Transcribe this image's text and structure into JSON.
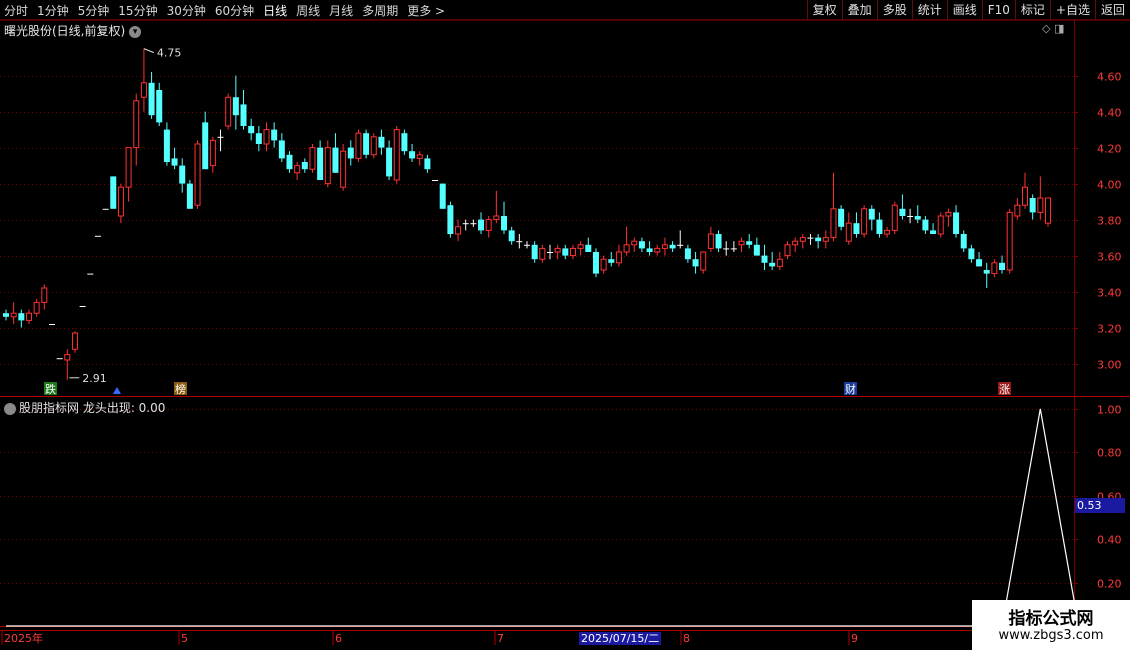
{
  "toolbar": {
    "periods": [
      "分时",
      "1分钟",
      "5分钟",
      "15分钟",
      "30分钟",
      "60分钟",
      "日线",
      "周线",
      "月线",
      "多周期",
      "更多 >"
    ],
    "active_period": "日线",
    "actions": [
      "复权",
      "叠加",
      "多股",
      "统计",
      "画线",
      "F10",
      "标记",
      "+自选",
      "返回"
    ]
  },
  "chart_header": {
    "title": "曙光股份(日线,前复权)",
    "menu_icon": "chevron-down-icon"
  },
  "indicator": {
    "title": "股朋指标网 龙头出现: 0.00",
    "current_value": "0.53"
  },
  "annotations": {
    "high": "4.75",
    "low": "2.91",
    "badges": [
      "跌",
      "榜",
      "财",
      "涨"
    ]
  },
  "watermark": {
    "title": "指标公式网",
    "url": "www.zbgs3.com"
  },
  "time_axis": {
    "labels": [
      "2025年",
      "5",
      "6",
      "7",
      "2025/07/15/二",
      "8",
      "9"
    ],
    "cursor_date": "2025/07/15/二"
  },
  "colors": {
    "up": "#ff3232",
    "down": "#54ffff",
    "grid": "#7a0000",
    "axis_text": "#ff3a3a",
    "flat": "#ffffff"
  },
  "chart_data": [
    {
      "type": "candlestick",
      "title": "曙光股份(日线,前复权)",
      "y_ticks": [
        "4.60",
        "4.40",
        "4.20",
        "4.00",
        "3.80",
        "3.60",
        "3.40",
        "3.20",
        "3.00"
      ],
      "ylim": [
        2.82,
        4.82
      ],
      "x_labels": [
        "2025年",
        "5",
        "6",
        "7",
        "8",
        "9"
      ],
      "ohlc": [
        [
          3.28,
          3.3,
          3.24,
          3.26
        ],
        [
          3.26,
          3.34,
          3.22,
          3.28
        ],
        [
          3.28,
          3.3,
          3.2,
          3.24
        ],
        [
          3.24,
          3.3,
          3.22,
          3.28
        ],
        [
          3.28,
          3.36,
          3.26,
          3.34
        ],
        [
          3.34,
          3.44,
          3.3,
          3.42
        ],
        [
          3.22,
          3.22,
          3.22,
          3.22
        ],
        [
          3.03,
          3.03,
          3.03,
          3.03
        ],
        [
          3.02,
          3.08,
          2.91,
          3.05
        ],
        [
          3.08,
          3.18,
          3.06,
          3.17
        ],
        [
          3.32,
          3.32,
          3.32,
          3.32
        ],
        [
          3.5,
          3.5,
          3.5,
          3.5
        ],
        [
          3.71,
          3.71,
          3.71,
          3.71
        ],
        [
          3.86,
          3.86,
          3.86,
          3.86
        ],
        [
          4.04,
          4.04,
          3.86,
          3.86
        ],
        [
          3.82,
          4.0,
          3.78,
          3.98
        ],
        [
          3.98,
          4.2,
          3.9,
          4.2
        ],
        [
          4.2,
          4.5,
          4.1,
          4.46
        ],
        [
          4.48,
          4.75,
          4.4,
          4.56
        ],
        [
          4.56,
          4.62,
          4.36,
          4.38
        ],
        [
          4.52,
          4.56,
          4.32,
          4.34
        ],
        [
          4.3,
          4.34,
          4.1,
          4.12
        ],
        [
          4.14,
          4.2,
          4.08,
          4.1
        ],
        [
          4.1,
          4.14,
          3.95,
          4.0
        ],
        [
          4.0,
          4.02,
          3.86,
          3.86
        ],
        [
          3.88,
          4.24,
          3.86,
          4.22
        ],
        [
          4.34,
          4.4,
          4.08,
          4.08
        ],
        [
          4.1,
          4.26,
          4.06,
          4.24
        ],
        [
          4.26,
          4.3,
          4.18,
          4.26
        ],
        [
          4.32,
          4.5,
          4.3,
          4.48
        ],
        [
          4.48,
          4.6,
          4.3,
          4.38
        ],
        [
          4.44,
          4.52,
          4.3,
          4.32
        ],
        [
          4.32,
          4.36,
          4.24,
          4.28
        ],
        [
          4.28,
          4.32,
          4.18,
          4.22
        ],
        [
          4.22,
          4.34,
          4.18,
          4.3
        ],
        [
          4.3,
          4.34,
          4.2,
          4.24
        ],
        [
          4.24,
          4.28,
          4.12,
          4.14
        ],
        [
          4.16,
          4.18,
          4.06,
          4.08
        ],
        [
          4.06,
          4.12,
          4.02,
          4.1
        ],
        [
          4.12,
          4.14,
          4.06,
          4.08
        ],
        [
          4.08,
          4.22,
          4.06,
          4.2
        ],
        [
          4.2,
          4.24,
          4.02,
          4.02
        ],
        [
          4.0,
          4.24,
          3.98,
          4.2
        ],
        [
          4.2,
          4.28,
          4.06,
          4.06
        ],
        [
          3.98,
          4.22,
          3.96,
          4.18
        ],
        [
          4.2,
          4.24,
          4.1,
          4.14
        ],
        [
          4.14,
          4.3,
          4.12,
          4.28
        ],
        [
          4.28,
          4.3,
          4.14,
          4.16
        ],
        [
          4.16,
          4.28,
          4.14,
          4.26
        ],
        [
          4.26,
          4.3,
          4.16,
          4.2
        ],
        [
          4.2,
          4.24,
          4.02,
          4.04
        ],
        [
          4.02,
          4.32,
          4.0,
          4.3
        ],
        [
          4.28,
          4.3,
          4.16,
          4.18
        ],
        [
          4.18,
          4.22,
          4.12,
          4.14
        ],
        [
          4.14,
          4.18,
          4.1,
          4.16
        ],
        [
          4.14,
          4.16,
          4.06,
          4.08
        ],
        [
          4.02,
          4.02,
          4.02,
          4.02
        ],
        [
          4.0,
          4.0,
          3.86,
          3.86
        ],
        [
          3.88,
          3.9,
          3.7,
          3.72
        ],
        [
          3.72,
          3.8,
          3.68,
          3.76
        ],
        [
          3.78,
          3.8,
          3.74,
          3.78
        ],
        [
          3.78,
          3.8,
          3.76,
          3.78
        ],
        [
          3.8,
          3.84,
          3.72,
          3.74
        ],
        [
          3.74,
          3.82,
          3.7,
          3.8
        ],
        [
          3.8,
          3.96,
          3.78,
          3.82
        ],
        [
          3.82,
          3.9,
          3.72,
          3.74
        ],
        [
          3.74,
          3.76,
          3.66,
          3.68
        ],
        [
          3.68,
          3.72,
          3.64,
          3.68
        ],
        [
          3.66,
          3.68,
          3.64,
          3.66
        ],
        [
          3.66,
          3.68,
          3.56,
          3.58
        ],
        [
          3.58,
          3.66,
          3.56,
          3.64
        ],
        [
          3.62,
          3.66,
          3.58,
          3.62
        ],
        [
          3.62,
          3.66,
          3.58,
          3.64
        ],
        [
          3.64,
          3.66,
          3.58,
          3.6
        ],
        [
          3.6,
          3.66,
          3.58,
          3.64
        ],
        [
          3.64,
          3.68,
          3.6,
          3.66
        ],
        [
          3.66,
          3.7,
          3.62,
          3.62
        ],
        [
          3.62,
          3.64,
          3.48,
          3.5
        ],
        [
          3.52,
          3.6,
          3.5,
          3.58
        ],
        [
          3.58,
          3.62,
          3.54,
          3.56
        ],
        [
          3.56,
          3.66,
          3.54,
          3.62
        ],
        [
          3.62,
          3.76,
          3.6,
          3.66
        ],
        [
          3.66,
          3.7,
          3.62,
          3.68
        ],
        [
          3.68,
          3.7,
          3.62,
          3.64
        ],
        [
          3.64,
          3.68,
          3.6,
          3.62
        ],
        [
          3.62,
          3.66,
          3.6,
          3.64
        ],
        [
          3.64,
          3.7,
          3.6,
          3.66
        ],
        [
          3.66,
          3.68,
          3.62,
          3.64
        ],
        [
          3.66,
          3.74,
          3.64,
          3.66
        ],
        [
          3.64,
          3.66,
          3.56,
          3.58
        ],
        [
          3.58,
          3.62,
          3.5,
          3.54
        ],
        [
          3.52,
          3.62,
          3.5,
          3.62
        ],
        [
          3.64,
          3.76,
          3.62,
          3.72
        ],
        [
          3.72,
          3.74,
          3.62,
          3.64
        ],
        [
          3.64,
          3.68,
          3.6,
          3.64
        ],
        [
          3.64,
          3.68,
          3.62,
          3.64
        ],
        [
          3.66,
          3.7,
          3.62,
          3.68
        ],
        [
          3.68,
          3.72,
          3.64,
          3.66
        ],
        [
          3.66,
          3.7,
          3.6,
          3.6
        ],
        [
          3.6,
          3.66,
          3.52,
          3.56
        ],
        [
          3.56,
          3.62,
          3.52,
          3.54
        ],
        [
          3.54,
          3.62,
          3.52,
          3.58
        ],
        [
          3.6,
          3.68,
          3.58,
          3.66
        ],
        [
          3.66,
          3.7,
          3.62,
          3.68
        ],
        [
          3.68,
          3.72,
          3.64,
          3.7
        ],
        [
          3.7,
          3.72,
          3.66,
          3.7
        ],
        [
          3.7,
          3.72,
          3.64,
          3.68
        ],
        [
          3.68,
          3.74,
          3.64,
          3.7
        ],
        [
          3.7,
          4.06,
          3.68,
          3.86
        ],
        [
          3.86,
          3.88,
          3.74,
          3.76
        ],
        [
          3.68,
          3.84,
          3.66,
          3.78
        ],
        [
          3.78,
          3.84,
          3.7,
          3.72
        ],
        [
          3.72,
          3.88,
          3.7,
          3.86
        ],
        [
          3.86,
          3.88,
          3.74,
          3.8
        ],
        [
          3.8,
          3.84,
          3.7,
          3.72
        ],
        [
          3.72,
          3.76,
          3.7,
          3.74
        ],
        [
          3.74,
          3.9,
          3.72,
          3.88
        ],
        [
          3.86,
          3.94,
          3.8,
          3.82
        ],
        [
          3.82,
          3.86,
          3.78,
          3.82
        ],
        [
          3.82,
          3.88,
          3.78,
          3.8
        ],
        [
          3.8,
          3.82,
          3.72,
          3.74
        ],
        [
          3.74,
          3.78,
          3.72,
          3.72
        ],
        [
          3.72,
          3.84,
          3.7,
          3.82
        ],
        [
          3.82,
          3.86,
          3.76,
          3.84
        ],
        [
          3.84,
          3.88,
          3.7,
          3.72
        ],
        [
          3.72,
          3.74,
          3.62,
          3.64
        ],
        [
          3.64,
          3.66,
          3.56,
          3.58
        ],
        [
          3.58,
          3.62,
          3.54,
          3.54
        ],
        [
          3.52,
          3.56,
          3.42,
          3.5
        ],
        [
          3.5,
          3.58,
          3.48,
          3.56
        ],
        [
          3.56,
          3.6,
          3.5,
          3.52
        ],
        [
          3.52,
          3.86,
          3.5,
          3.84
        ],
        [
          3.82,
          3.92,
          3.8,
          3.88
        ],
        [
          3.88,
          4.06,
          3.86,
          3.98
        ],
        [
          3.92,
          3.94,
          3.8,
          3.84
        ],
        [
          3.84,
          4.04,
          3.8,
          3.92
        ],
        [
          3.78,
          3.92,
          3.76,
          3.92
        ]
      ]
    },
    {
      "type": "line",
      "title": "股朋指标网 龙头出现: 0.00",
      "y_ticks": [
        "1.00",
        "0.80",
        "0.60",
        "0.40",
        "0.20"
      ],
      "ylim": [
        0,
        1.05
      ],
      "series": [
        {
          "name": "龙头出现",
          "values": [
            0.0,
            0.0,
            1.0,
            0.0
          ],
          "x_index": [
            0,
            130,
            135,
            140
          ]
        }
      ]
    }
  ]
}
